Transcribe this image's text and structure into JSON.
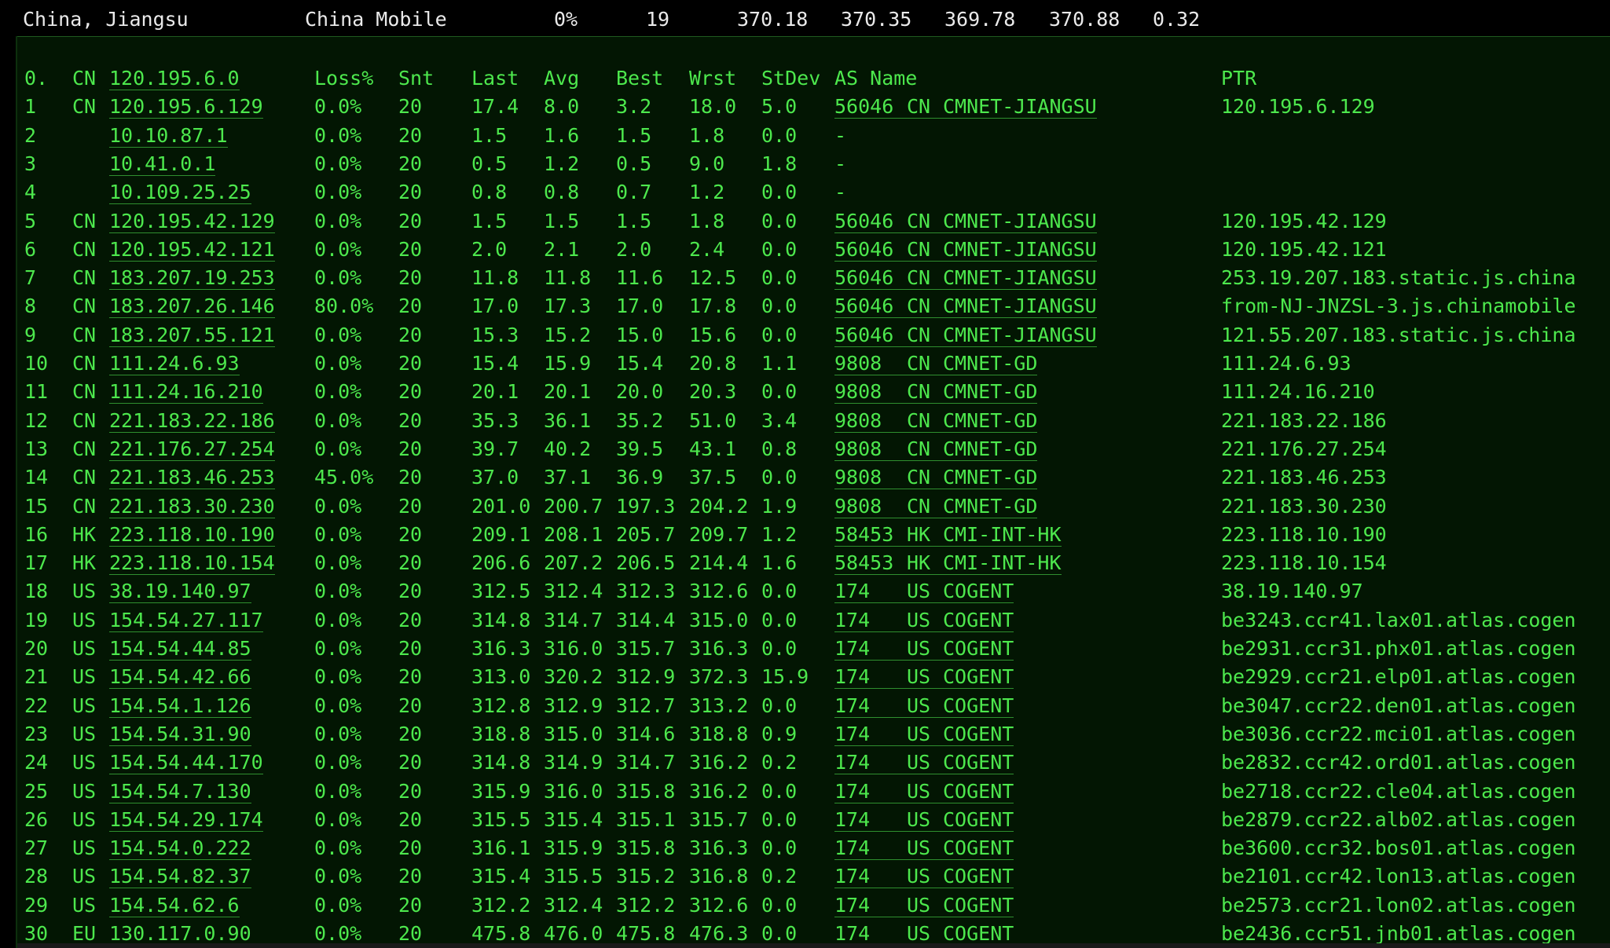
{
  "summary": {
    "location": "China, Jiangsu",
    "isp": "China Mobile",
    "loss": "0%",
    "sent": "19",
    "last": "370.18",
    "avg": "370.35",
    "best": "369.78",
    "worst": "370.88",
    "stdev": "0.32"
  },
  "headers": {
    "hop": "0.",
    "cc": "CN",
    "host": "120.195.6.0",
    "loss": "Loss%",
    "snt": "Snt",
    "last": "Last",
    "avg": "Avg",
    "best": "Best",
    "wrst": "Wrst",
    "stdev": "StDev",
    "as_name": "AS Name",
    "ptr": "PTR"
  },
  "hops": [
    {
      "hop": "1",
      "cc": "CN",
      "host": "120.195.6.129",
      "loss": "0.0%",
      "snt": "20",
      "last": "17.4",
      "avg": "8.0",
      "best": "3.2",
      "wrst": "18.0",
      "stdev": "5.0",
      "asn": "56046",
      "as_cc": "CN",
      "as_name": "CMNET-JIANGSU",
      "ptr": "120.195.6.129"
    },
    {
      "hop": "2",
      "cc": "",
      "host": "10.10.87.1",
      "loss": "0.0%",
      "snt": "20",
      "last": "1.5",
      "avg": "1.6",
      "best": "1.5",
      "wrst": "1.8",
      "stdev": "0.0",
      "asn": "-",
      "as_cc": "",
      "as_name": "",
      "ptr": ""
    },
    {
      "hop": "3",
      "cc": "",
      "host": "10.41.0.1",
      "loss": "0.0%",
      "snt": "20",
      "last": "0.5",
      "avg": "1.2",
      "best": "0.5",
      "wrst": "9.0",
      "stdev": "1.8",
      "asn": "-",
      "as_cc": "",
      "as_name": "",
      "ptr": ""
    },
    {
      "hop": "4",
      "cc": "",
      "host": "10.109.25.25",
      "loss": "0.0%",
      "snt": "20",
      "last": "0.8",
      "avg": "0.8",
      "best": "0.7",
      "wrst": "1.2",
      "stdev": "0.0",
      "asn": "-",
      "as_cc": "",
      "as_name": "",
      "ptr": ""
    },
    {
      "hop": "5",
      "cc": "CN",
      "host": "120.195.42.129",
      "loss": "0.0%",
      "snt": "20",
      "last": "1.5",
      "avg": "1.5",
      "best": "1.5",
      "wrst": "1.8",
      "stdev": "0.0",
      "asn": "56046",
      "as_cc": "CN",
      "as_name": "CMNET-JIANGSU",
      "ptr": "120.195.42.129"
    },
    {
      "hop": "6",
      "cc": "CN",
      "host": "120.195.42.121",
      "loss": "0.0%",
      "snt": "20",
      "last": "2.0",
      "avg": "2.1",
      "best": "2.0",
      "wrst": "2.4",
      "stdev": "0.0",
      "asn": "56046",
      "as_cc": "CN",
      "as_name": "CMNET-JIANGSU",
      "ptr": "120.195.42.121"
    },
    {
      "hop": "7",
      "cc": "CN",
      "host": "183.207.19.253",
      "loss": "0.0%",
      "snt": "20",
      "last": "11.8",
      "avg": "11.8",
      "best": "11.6",
      "wrst": "12.5",
      "stdev": "0.0",
      "asn": "56046",
      "as_cc": "CN",
      "as_name": "CMNET-JIANGSU",
      "ptr": "253.19.207.183.static.js.china"
    },
    {
      "hop": "8",
      "cc": "CN",
      "host": "183.207.26.146",
      "loss": "80.0%",
      "snt": "20",
      "last": "17.0",
      "avg": "17.3",
      "best": "17.0",
      "wrst": "17.8",
      "stdev": "0.0",
      "asn": "56046",
      "as_cc": "CN",
      "as_name": "CMNET-JIANGSU",
      "ptr": "from-NJ-JNZSL-3.js.chinamobile"
    },
    {
      "hop": "9",
      "cc": "CN",
      "host": "183.207.55.121",
      "loss": "0.0%",
      "snt": "20",
      "last": "15.3",
      "avg": "15.2",
      "best": "15.0",
      "wrst": "15.6",
      "stdev": "0.0",
      "asn": "56046",
      "as_cc": "CN",
      "as_name": "CMNET-JIANGSU",
      "ptr": "121.55.207.183.static.js.china"
    },
    {
      "hop": "10",
      "cc": "CN",
      "host": "111.24.6.93",
      "loss": "0.0%",
      "snt": "20",
      "last": "15.4",
      "avg": "15.9",
      "best": "15.4",
      "wrst": "20.8",
      "stdev": "1.1",
      "asn": "9808",
      "as_cc": "CN",
      "as_name": "CMNET-GD",
      "ptr": "111.24.6.93"
    },
    {
      "hop": "11",
      "cc": "CN",
      "host": "111.24.16.210",
      "loss": "0.0%",
      "snt": "20",
      "last": "20.1",
      "avg": "20.1",
      "best": "20.0",
      "wrst": "20.3",
      "stdev": "0.0",
      "asn": "9808",
      "as_cc": "CN",
      "as_name": "CMNET-GD",
      "ptr": "111.24.16.210"
    },
    {
      "hop": "12",
      "cc": "CN",
      "host": "221.183.22.186",
      "loss": "0.0%",
      "snt": "20",
      "last": "35.3",
      "avg": "36.1",
      "best": "35.2",
      "wrst": "51.0",
      "stdev": "3.4",
      "asn": "9808",
      "as_cc": "CN",
      "as_name": "CMNET-GD",
      "ptr": "221.183.22.186"
    },
    {
      "hop": "13",
      "cc": "CN",
      "host": "221.176.27.254",
      "loss": "0.0%",
      "snt": "20",
      "last": "39.7",
      "avg": "40.2",
      "best": "39.5",
      "wrst": "43.1",
      "stdev": "0.8",
      "asn": "9808",
      "as_cc": "CN",
      "as_name": "CMNET-GD",
      "ptr": "221.176.27.254"
    },
    {
      "hop": "14",
      "cc": "CN",
      "host": "221.183.46.253",
      "loss": "45.0%",
      "snt": "20",
      "last": "37.0",
      "avg": "37.1",
      "best": "36.9",
      "wrst": "37.5",
      "stdev": "0.0",
      "asn": "9808",
      "as_cc": "CN",
      "as_name": "CMNET-GD",
      "ptr": "221.183.46.253"
    },
    {
      "hop": "15",
      "cc": "CN",
      "host": "221.183.30.230",
      "loss": "0.0%",
      "snt": "20",
      "last": "201.0",
      "avg": "200.7",
      "best": "197.3",
      "wrst": "204.2",
      "stdev": "1.9",
      "asn": "9808",
      "as_cc": "CN",
      "as_name": "CMNET-GD",
      "ptr": "221.183.30.230"
    },
    {
      "hop": "16",
      "cc": "HK",
      "host": "223.118.10.190",
      "loss": "0.0%",
      "snt": "20",
      "last": "209.1",
      "avg": "208.1",
      "best": "205.7",
      "wrst": "209.7",
      "stdev": "1.2",
      "asn": "58453",
      "as_cc": "HK",
      "as_name": "CMI-INT-HK",
      "ptr": "223.118.10.190"
    },
    {
      "hop": "17",
      "cc": "HK",
      "host": "223.118.10.154",
      "loss": "0.0%",
      "snt": "20",
      "last": "206.6",
      "avg": "207.2",
      "best": "206.5",
      "wrst": "214.4",
      "stdev": "1.6",
      "asn": "58453",
      "as_cc": "HK",
      "as_name": "CMI-INT-HK",
      "ptr": "223.118.10.154"
    },
    {
      "hop": "18",
      "cc": "US",
      "host": "38.19.140.97",
      "loss": "0.0%",
      "snt": "20",
      "last": "312.5",
      "avg": "312.4",
      "best": "312.3",
      "wrst": "312.6",
      "stdev": "0.0",
      "asn": "174",
      "as_cc": "US",
      "as_name": "COGENT",
      "ptr": "38.19.140.97"
    },
    {
      "hop": "19",
      "cc": "US",
      "host": "154.54.27.117",
      "loss": "0.0%",
      "snt": "20",
      "last": "314.8",
      "avg": "314.7",
      "best": "314.4",
      "wrst": "315.0",
      "stdev": "0.0",
      "asn": "174",
      "as_cc": "US",
      "as_name": "COGENT",
      "ptr": "be3243.ccr41.lax01.atlas.cogen"
    },
    {
      "hop": "20",
      "cc": "US",
      "host": "154.54.44.85",
      "loss": "0.0%",
      "snt": "20",
      "last": "316.3",
      "avg": "316.0",
      "best": "315.7",
      "wrst": "316.3",
      "stdev": "0.0",
      "asn": "174",
      "as_cc": "US",
      "as_name": "COGENT",
      "ptr": "be2931.ccr31.phx01.atlas.cogen"
    },
    {
      "hop": "21",
      "cc": "US",
      "host": "154.54.42.66",
      "loss": "0.0%",
      "snt": "20",
      "last": "313.0",
      "avg": "320.2",
      "best": "312.9",
      "wrst": "372.3",
      "stdev": "15.9",
      "asn": "174",
      "as_cc": "US",
      "as_name": "COGENT",
      "ptr": "be2929.ccr21.elp01.atlas.cogen"
    },
    {
      "hop": "22",
      "cc": "US",
      "host": "154.54.1.126",
      "loss": "0.0%",
      "snt": "20",
      "last": "312.8",
      "avg": "312.9",
      "best": "312.7",
      "wrst": "313.2",
      "stdev": "0.0",
      "asn": "174",
      "as_cc": "US",
      "as_name": "COGENT",
      "ptr": "be3047.ccr22.den01.atlas.cogen"
    },
    {
      "hop": "23",
      "cc": "US",
      "host": "154.54.31.90",
      "loss": "0.0%",
      "snt": "20",
      "last": "318.8",
      "avg": "315.0",
      "best": "314.6",
      "wrst": "318.8",
      "stdev": "0.9",
      "asn": "174",
      "as_cc": "US",
      "as_name": "COGENT",
      "ptr": "be3036.ccr22.mci01.atlas.cogen"
    },
    {
      "hop": "24",
      "cc": "US",
      "host": "154.54.44.170",
      "loss": "0.0%",
      "snt": "20",
      "last": "314.8",
      "avg": "314.9",
      "best": "314.7",
      "wrst": "316.2",
      "stdev": "0.2",
      "asn": "174",
      "as_cc": "US",
      "as_name": "COGENT",
      "ptr": "be2832.ccr42.ord01.atlas.cogen"
    },
    {
      "hop": "25",
      "cc": "US",
      "host": "154.54.7.130",
      "loss": "0.0%",
      "snt": "20",
      "last": "315.9",
      "avg": "316.0",
      "best": "315.8",
      "wrst": "316.2",
      "stdev": "0.0",
      "asn": "174",
      "as_cc": "US",
      "as_name": "COGENT",
      "ptr": "be2718.ccr22.cle04.atlas.cogen"
    },
    {
      "hop": "26",
      "cc": "US",
      "host": "154.54.29.174",
      "loss": "0.0%",
      "snt": "20",
      "last": "315.5",
      "avg": "315.4",
      "best": "315.1",
      "wrst": "315.7",
      "stdev": "0.0",
      "asn": "174",
      "as_cc": "US",
      "as_name": "COGENT",
      "ptr": "be2879.ccr22.alb02.atlas.cogen"
    },
    {
      "hop": "27",
      "cc": "US",
      "host": "154.54.0.222",
      "loss": "0.0%",
      "snt": "20",
      "last": "316.1",
      "avg": "315.9",
      "best": "315.8",
      "wrst": "316.3",
      "stdev": "0.0",
      "asn": "174",
      "as_cc": "US",
      "as_name": "COGENT",
      "ptr": "be3600.ccr32.bos01.atlas.cogen"
    },
    {
      "hop": "28",
      "cc": "US",
      "host": "154.54.82.37",
      "loss": "0.0%",
      "snt": "20",
      "last": "315.4",
      "avg": "315.5",
      "best": "315.2",
      "wrst": "316.8",
      "stdev": "0.2",
      "asn": "174",
      "as_cc": "US",
      "as_name": "COGENT",
      "ptr": "be2101.ccr42.lon13.atlas.cogen"
    },
    {
      "hop": "29",
      "cc": "US",
      "host": "154.54.62.6",
      "loss": "0.0%",
      "snt": "20",
      "last": "312.2",
      "avg": "312.4",
      "best": "312.2",
      "wrst": "312.6",
      "stdev": "0.0",
      "asn": "174",
      "as_cc": "US",
      "as_name": "COGENT",
      "ptr": "be2573.ccr21.lon02.atlas.cogen"
    },
    {
      "hop": "30",
      "cc": "EU",
      "host": "130.117.0.90",
      "loss": "0.0%",
      "snt": "20",
      "last": "475.8",
      "avg": "476.0",
      "best": "475.8",
      "wrst": "476.3",
      "stdev": "0.0",
      "asn": "174",
      "as_cc": "US",
      "as_name": "COGENT",
      "ptr": "be2436.ccr51.jnb01.atlas.cogen"
    }
  ]
}
